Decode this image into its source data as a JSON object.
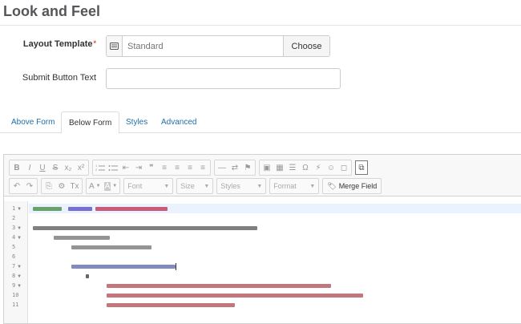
{
  "page": {
    "title": "Look and Feel"
  },
  "form": {
    "layout_template_label": "Layout Template",
    "required_mark": "*",
    "layout_template_placeholder": "Standard",
    "choose_label": "Choose",
    "submit_button_label": "Submit Button Text",
    "submit_button_value": ""
  },
  "tabs": [
    {
      "label": "Above Form",
      "active": false
    },
    {
      "label": "Below Form",
      "active": true
    },
    {
      "label": "Styles",
      "active": false
    },
    {
      "label": "Advanced",
      "active": false
    }
  ],
  "toolbar": {
    "row1": [
      "B",
      "I",
      "U",
      "S",
      "x₂",
      "x²",
      "ol",
      "ul",
      "⇤",
      "⇥",
      "❞",
      "≡",
      "≡",
      "≡",
      "≡",
      "—",
      "⇄",
      "⚑",
      "▣",
      "▦",
      "☰",
      "Ω",
      "⚡",
      "☺",
      "◻",
      "⧉"
    ],
    "row2": [
      "↶",
      "↷",
      "⎘",
      "⚙",
      "Tx",
      "A",
      "A"
    ],
    "font_label": "Font",
    "size_label": "Size",
    "styles_label": "Styles",
    "format_label": "Format",
    "merge_field_label": "Merge Field"
  },
  "code_editor": {
    "line_numbers": [
      "1",
      "2",
      "3",
      "4",
      "5",
      "6",
      "7",
      "8",
      "9",
      "10",
      "11"
    ]
  },
  "colors": {
    "link": "#1f6fa8",
    "title": "#54575a",
    "required": "#e4572e"
  }
}
